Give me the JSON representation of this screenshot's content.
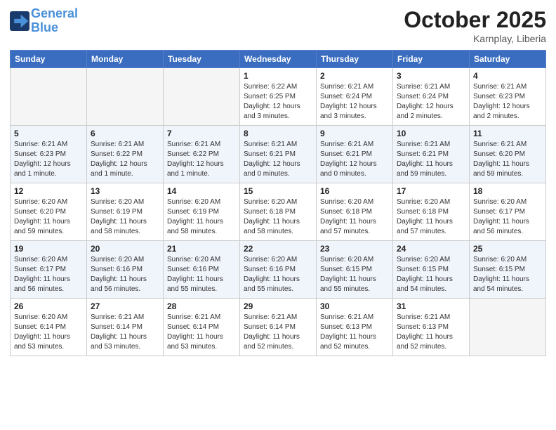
{
  "header": {
    "logo_line1": "General",
    "logo_line2": "Blue",
    "month_title": "October 2025",
    "location": "Karnplay, Liberia"
  },
  "weekdays": [
    "Sunday",
    "Monday",
    "Tuesday",
    "Wednesday",
    "Thursday",
    "Friday",
    "Saturday"
  ],
  "weeks": [
    [
      {
        "day": "",
        "info": ""
      },
      {
        "day": "",
        "info": ""
      },
      {
        "day": "",
        "info": ""
      },
      {
        "day": "1",
        "info": "Sunrise: 6:22 AM\nSunset: 6:25 PM\nDaylight: 12 hours\nand 3 minutes."
      },
      {
        "day": "2",
        "info": "Sunrise: 6:21 AM\nSunset: 6:24 PM\nDaylight: 12 hours\nand 3 minutes."
      },
      {
        "day": "3",
        "info": "Sunrise: 6:21 AM\nSunset: 6:24 PM\nDaylight: 12 hours\nand 2 minutes."
      },
      {
        "day": "4",
        "info": "Sunrise: 6:21 AM\nSunset: 6:23 PM\nDaylight: 12 hours\nand 2 minutes."
      }
    ],
    [
      {
        "day": "5",
        "info": "Sunrise: 6:21 AM\nSunset: 6:23 PM\nDaylight: 12 hours\nand 1 minute."
      },
      {
        "day": "6",
        "info": "Sunrise: 6:21 AM\nSunset: 6:22 PM\nDaylight: 12 hours\nand 1 minute."
      },
      {
        "day": "7",
        "info": "Sunrise: 6:21 AM\nSunset: 6:22 PM\nDaylight: 12 hours\nand 1 minute."
      },
      {
        "day": "8",
        "info": "Sunrise: 6:21 AM\nSunset: 6:21 PM\nDaylight: 12 hours\nand 0 minutes."
      },
      {
        "day": "9",
        "info": "Sunrise: 6:21 AM\nSunset: 6:21 PM\nDaylight: 12 hours\nand 0 minutes."
      },
      {
        "day": "10",
        "info": "Sunrise: 6:21 AM\nSunset: 6:21 PM\nDaylight: 11 hours\nand 59 minutes."
      },
      {
        "day": "11",
        "info": "Sunrise: 6:21 AM\nSunset: 6:20 PM\nDaylight: 11 hours\nand 59 minutes."
      }
    ],
    [
      {
        "day": "12",
        "info": "Sunrise: 6:20 AM\nSunset: 6:20 PM\nDaylight: 11 hours\nand 59 minutes."
      },
      {
        "day": "13",
        "info": "Sunrise: 6:20 AM\nSunset: 6:19 PM\nDaylight: 11 hours\nand 58 minutes."
      },
      {
        "day": "14",
        "info": "Sunrise: 6:20 AM\nSunset: 6:19 PM\nDaylight: 11 hours\nand 58 minutes."
      },
      {
        "day": "15",
        "info": "Sunrise: 6:20 AM\nSunset: 6:18 PM\nDaylight: 11 hours\nand 58 minutes."
      },
      {
        "day": "16",
        "info": "Sunrise: 6:20 AM\nSunset: 6:18 PM\nDaylight: 11 hours\nand 57 minutes."
      },
      {
        "day": "17",
        "info": "Sunrise: 6:20 AM\nSunset: 6:18 PM\nDaylight: 11 hours\nand 57 minutes."
      },
      {
        "day": "18",
        "info": "Sunrise: 6:20 AM\nSunset: 6:17 PM\nDaylight: 11 hours\nand 56 minutes."
      }
    ],
    [
      {
        "day": "19",
        "info": "Sunrise: 6:20 AM\nSunset: 6:17 PM\nDaylight: 11 hours\nand 56 minutes."
      },
      {
        "day": "20",
        "info": "Sunrise: 6:20 AM\nSunset: 6:16 PM\nDaylight: 11 hours\nand 56 minutes."
      },
      {
        "day": "21",
        "info": "Sunrise: 6:20 AM\nSunset: 6:16 PM\nDaylight: 11 hours\nand 55 minutes."
      },
      {
        "day": "22",
        "info": "Sunrise: 6:20 AM\nSunset: 6:16 PM\nDaylight: 11 hours\nand 55 minutes."
      },
      {
        "day": "23",
        "info": "Sunrise: 6:20 AM\nSunset: 6:15 PM\nDaylight: 11 hours\nand 55 minutes."
      },
      {
        "day": "24",
        "info": "Sunrise: 6:20 AM\nSunset: 6:15 PM\nDaylight: 11 hours\nand 54 minutes."
      },
      {
        "day": "25",
        "info": "Sunrise: 6:20 AM\nSunset: 6:15 PM\nDaylight: 11 hours\nand 54 minutes."
      }
    ],
    [
      {
        "day": "26",
        "info": "Sunrise: 6:20 AM\nSunset: 6:14 PM\nDaylight: 11 hours\nand 53 minutes."
      },
      {
        "day": "27",
        "info": "Sunrise: 6:21 AM\nSunset: 6:14 PM\nDaylight: 11 hours\nand 53 minutes."
      },
      {
        "day": "28",
        "info": "Sunrise: 6:21 AM\nSunset: 6:14 PM\nDaylight: 11 hours\nand 53 minutes."
      },
      {
        "day": "29",
        "info": "Sunrise: 6:21 AM\nSunset: 6:14 PM\nDaylight: 11 hours\nand 52 minutes."
      },
      {
        "day": "30",
        "info": "Sunrise: 6:21 AM\nSunset: 6:13 PM\nDaylight: 11 hours\nand 52 minutes."
      },
      {
        "day": "31",
        "info": "Sunrise: 6:21 AM\nSunset: 6:13 PM\nDaylight: 11 hours\nand 52 minutes."
      },
      {
        "day": "",
        "info": ""
      }
    ]
  ]
}
